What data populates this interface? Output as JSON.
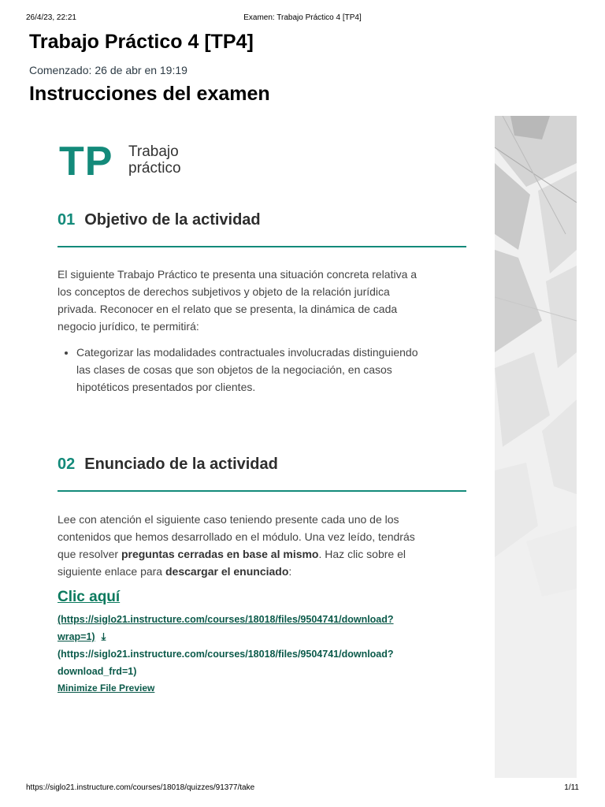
{
  "print_header": {
    "datetime": "26/4/23, 22:21",
    "page_title": "Examen: Trabajo Práctico 4 [TP4]"
  },
  "quiz": {
    "title": "Trabajo Práctico 4 [TP4]",
    "started_label": "Comenzado:",
    "started_value": "26 de abr en 19:19",
    "instructions_heading": "Instrucciones del examen"
  },
  "logo": {
    "letters": "TP",
    "line1": "Trabajo",
    "line2": "práctico"
  },
  "section1": {
    "number": "01",
    "title": "Objetivo de la actividad",
    "lines": [
      "El siguiente Trabajo Práctico te presenta una situación concreta relativa a",
      "los conceptos de derechos subjetivos y objeto de la relación jurídica",
      "privada. Reconocer en el relato que se presenta, la dinámica de cada",
      "negocio jurídico, te permitirá:"
    ],
    "bullet_lines": [
      "Categorizar las modalidades contractuales involucradas distinguiendo",
      "las clases de cosas que son objetos de la negociación, en casos",
      "hipotéticos presentados por clientes."
    ]
  },
  "section2": {
    "number": "02",
    "title": "Enunciado de la actividad",
    "line1": "Lee con atención el siguiente caso teniendo presente cada uno de los",
    "line2": "contenidos que hemos desarrollado en el módulo. Una vez leído, tendrás",
    "line3_pre": "que resolver ",
    "line3_bold": "preguntas cerradas en base al mismo",
    "line3_post": ". Haz clic sobre el",
    "line4_pre": "siguiente enlace para ",
    "line4_bold": "descargar el enunciado",
    "line4_post": ":"
  },
  "download": {
    "link_label": "Clic aquí",
    "url1_line1": "(https://siglo21.instructure.com/courses/18018/files/9504741/download?",
    "url1_line2": "wrap=1)",
    "download_icon": "download-icon",
    "url2_line1": "(https://siglo21.instructure.com/courses/18018/files/9504741/download?",
    "url2_line2": "download_frd=1)",
    "minimize_label": "Minimize File Preview"
  },
  "print_footer": {
    "url": "https://siglo21.instructure.com/courses/18018/quizzes/91377/take",
    "page": "1/11"
  },
  "colors": {
    "accent": "#138a7a",
    "link": "#0b5a4a",
    "heading": "#000000"
  }
}
